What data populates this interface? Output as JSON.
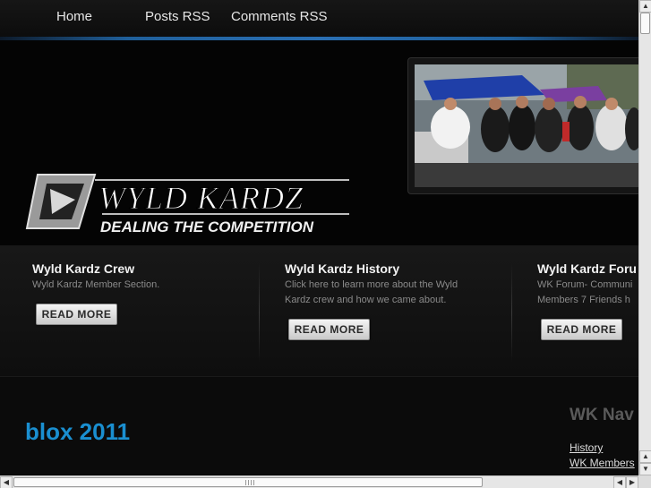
{
  "nav": {
    "items": [
      "Home",
      "Posts RSS",
      "Comments RSS"
    ]
  },
  "header": {
    "logo_text": "WYLD KARDZ",
    "logo_tagline": "DEALING THE COMPETITION"
  },
  "featured": [
    {
      "title": "Wyld Kardz Crew",
      "desc": [
        "Wyld Kardz Member Section."
      ],
      "button": "READ MORE"
    },
    {
      "title": "Wyld Kardz History",
      "desc": [
        "Click here to learn more about the Wyld",
        "Kardz crew and how we came about."
      ],
      "button": "READ MORE"
    },
    {
      "title": "Wyld Kardz Foru",
      "desc": [
        "WK Forum- Communi",
        "Members 7 Friends h"
      ],
      "button": "READ MORE"
    }
  ],
  "content": {
    "post_title": "blox 2011"
  },
  "sidebar": {
    "title": "WK Nav",
    "links": [
      "History",
      "WK Members"
    ]
  },
  "colors": {
    "accent_blue": "#1a8fd0",
    "nav_bar_blue": "#2a6fb3",
    "background": "#0b0b0b"
  },
  "icons": {
    "scroll_up": "arrow-up-icon",
    "scroll_down": "arrow-down-icon",
    "scroll_left": "arrow-left-icon",
    "scroll_right": "arrow-right-icon"
  }
}
